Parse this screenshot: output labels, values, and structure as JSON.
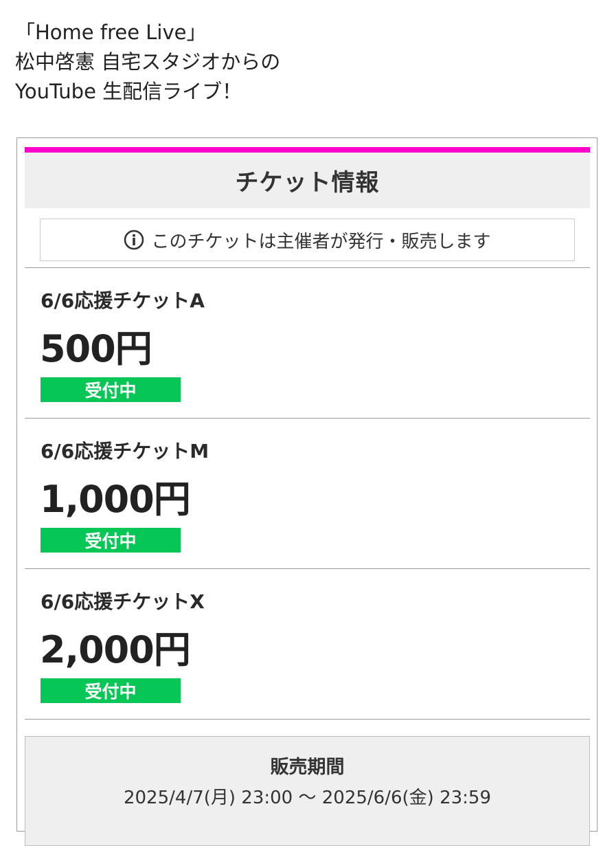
{
  "intro": {
    "line1": "「Home free Live」",
    "line2": "松中啓憲 自宅スタジオからの",
    "line3": "YouTube 生配信ライブ！"
  },
  "panel": {
    "title": "チケット情報",
    "accent_color": "#ff00cc",
    "notice": {
      "icon": "info-icon",
      "text": "このチケットは主催者が発行・販売します"
    }
  },
  "tickets": [
    {
      "name": "6/6応援チケットA",
      "price": "500円",
      "status": "受付中"
    },
    {
      "name": "6/6応援チケットM",
      "price": "1,000円",
      "status": "受付中"
    },
    {
      "name": "6/6応援チケットX",
      "price": "2,000円",
      "status": "受付中"
    }
  ],
  "status_color": "#06c755",
  "sales": {
    "label": "販売期間",
    "period": "2025/4/7(月) 23:00 〜 2025/6/6(金) 23:59"
  }
}
